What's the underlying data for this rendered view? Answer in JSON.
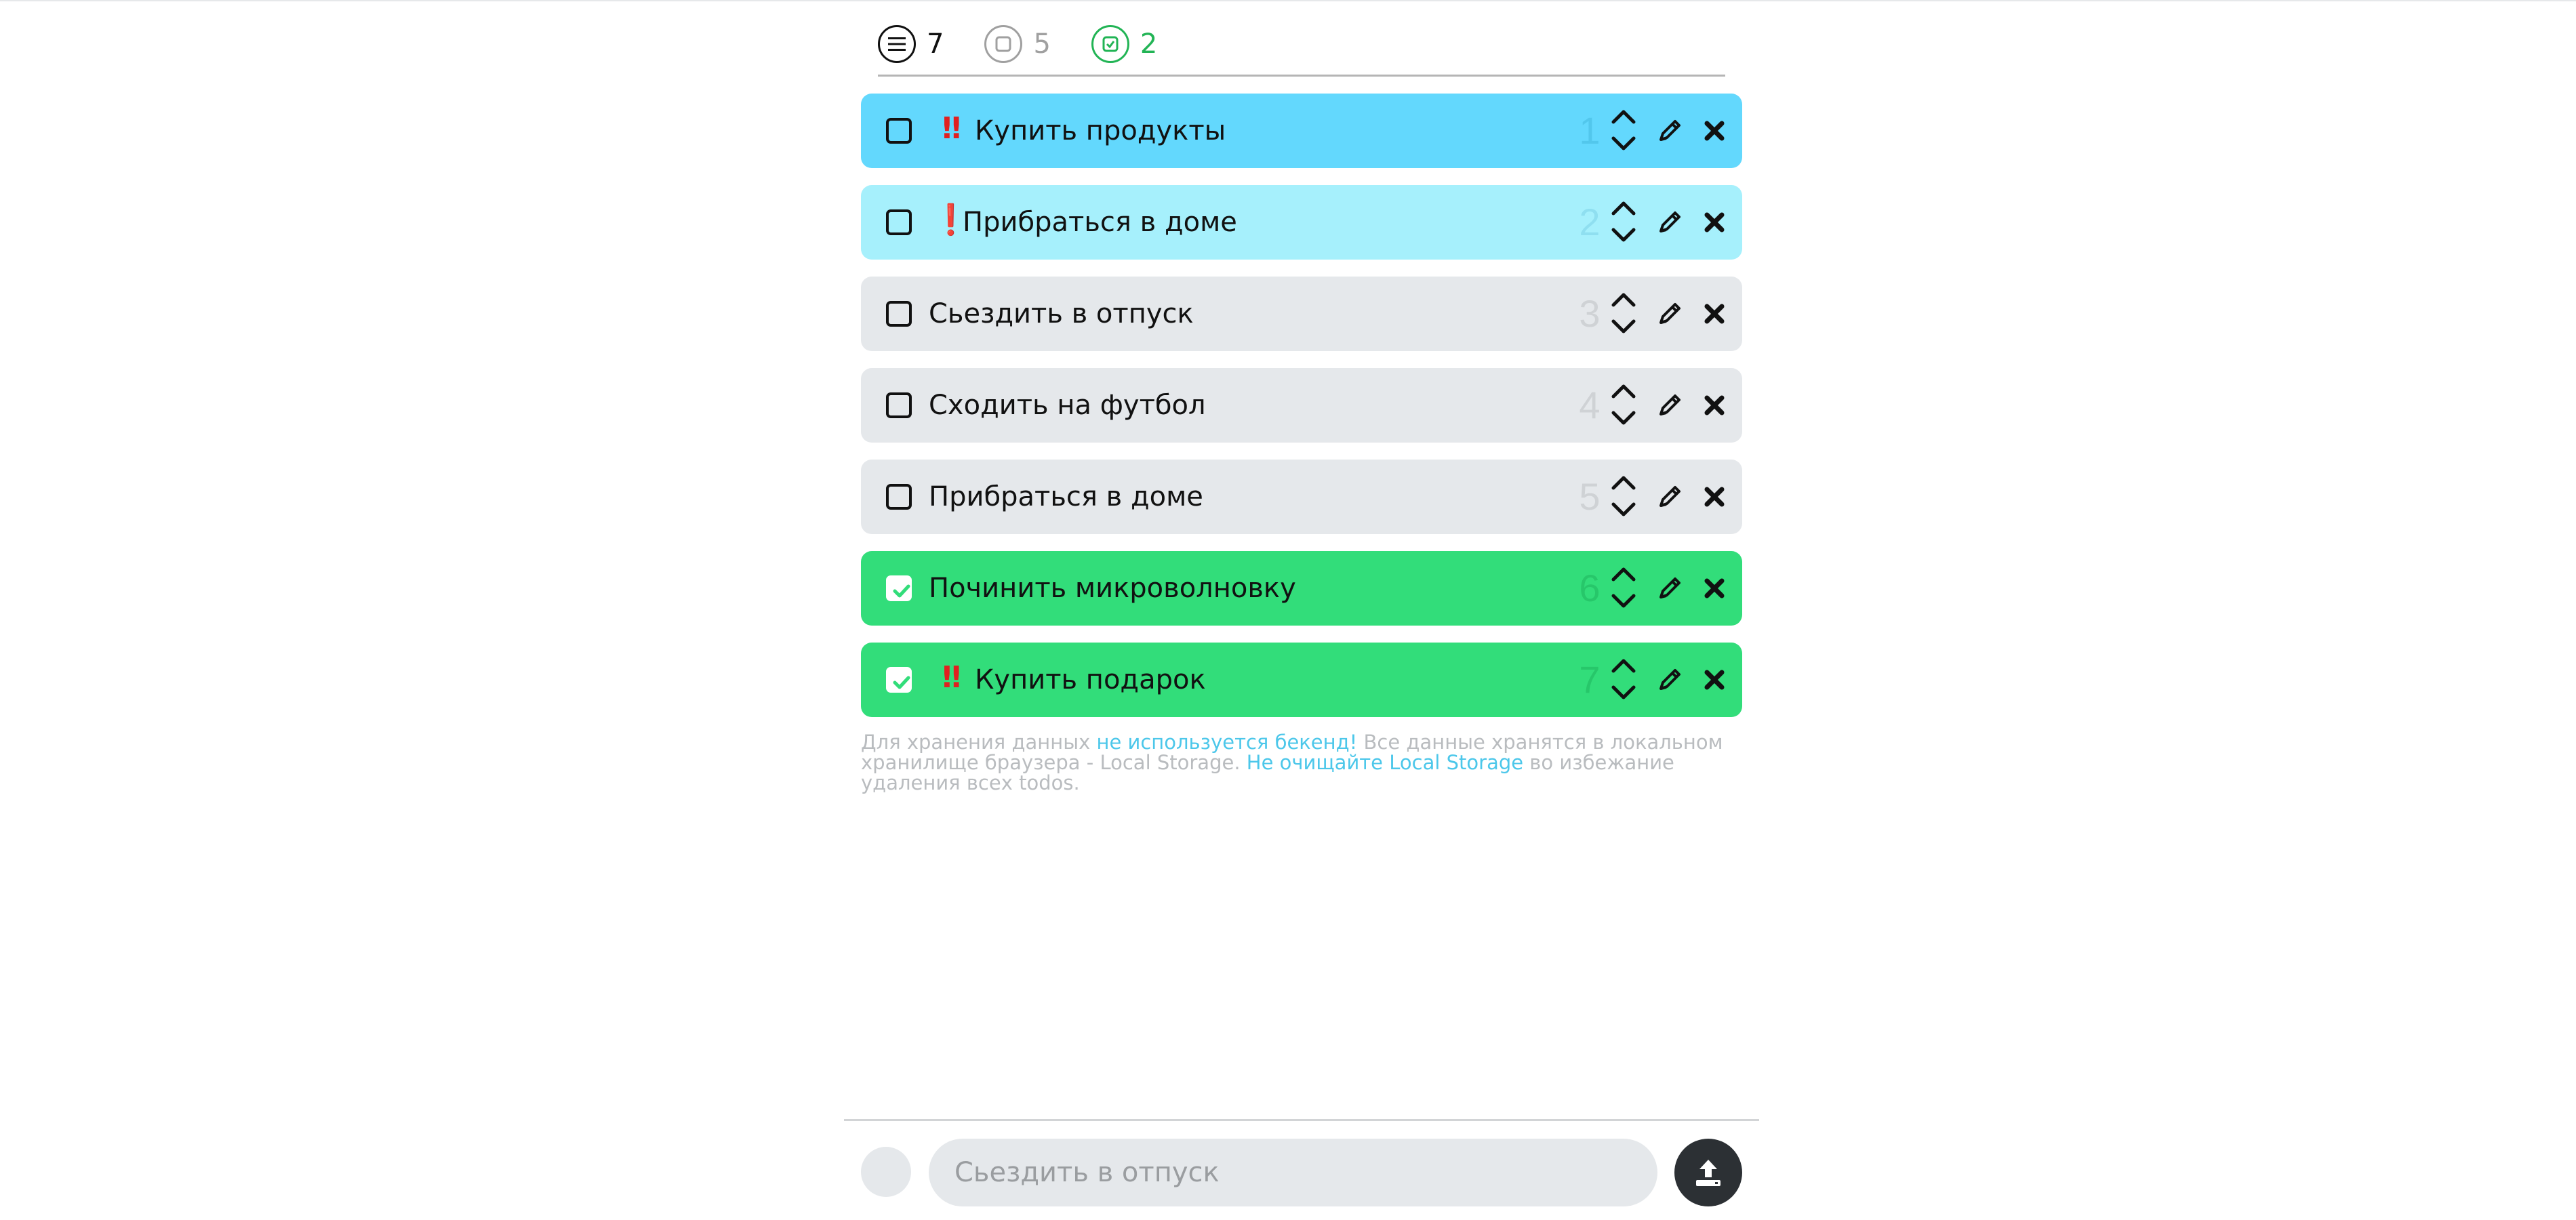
{
  "filters": {
    "all": {
      "count": "7",
      "icon": "list-icon"
    },
    "active": {
      "count": "5",
      "icon": "square-icon"
    },
    "completed": {
      "count": "2",
      "icon": "checked-square-icon"
    }
  },
  "todos": [
    {
      "number": "1",
      "priority": "‼",
      "title": "Купить продукты",
      "done": false,
      "level": "high"
    },
    {
      "number": "2",
      "priority": "❗",
      "title": "Прибраться в доме",
      "done": false,
      "level": "mid"
    },
    {
      "number": "3",
      "priority": "",
      "title": "Сьездить в отпуск",
      "done": false,
      "level": "normal"
    },
    {
      "number": "4",
      "priority": "",
      "title": "Сходить на футбол",
      "done": false,
      "level": "normal"
    },
    {
      "number": "5",
      "priority": "",
      "title": "Прибраться в доме",
      "done": false,
      "level": "normal"
    },
    {
      "number": "6",
      "priority": "",
      "title": "Починить микроволновку",
      "done": true,
      "level": "done"
    },
    {
      "number": "7",
      "priority": "‼",
      "title": "Купить подарок",
      "done": true,
      "level": "done"
    }
  ],
  "note": {
    "part1": "Для хранения данных ",
    "link1": "не используется бекенд!",
    "part2": " Все данные хранятся в локальном хранилище браузера - Local Storage. ",
    "link2": "Не очищайте Local Storage",
    "part3": " во избежание удаления всех todos."
  },
  "input": {
    "placeholder": "Сьездить в отпуск"
  },
  "colors": {
    "high": "#63d8fd",
    "mid": "#a6f0fc",
    "normal": "#e5e8eb",
    "done": "#32dd7a",
    "link": "#4cc7ea"
  }
}
